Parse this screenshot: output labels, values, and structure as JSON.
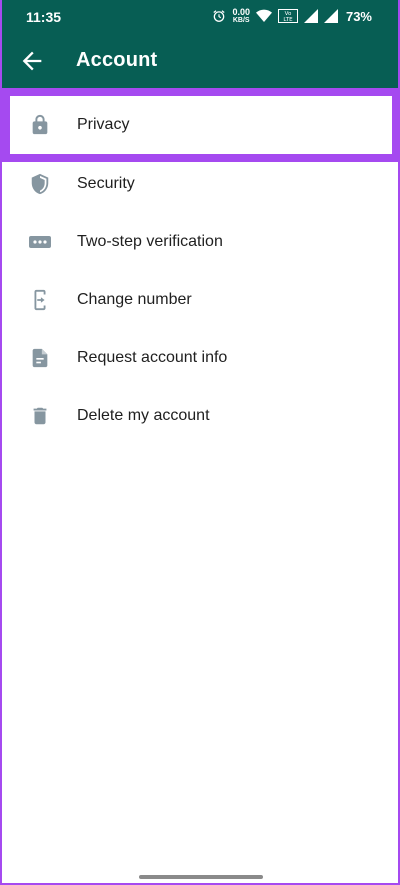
{
  "status_bar": {
    "time": "11:35",
    "net_speed_value": "0.00",
    "net_speed_unit": "KB/S",
    "battery": "73%",
    "icons": [
      "alarm-icon",
      "wifi-icon",
      "volte-icon",
      "signal-icon",
      "signal-icon"
    ]
  },
  "app_bar": {
    "title": "Account",
    "back_icon": "arrow-left-icon"
  },
  "menu": {
    "items": [
      {
        "label": "Privacy",
        "icon": "lock-icon"
      },
      {
        "label": "Security",
        "icon": "shield-icon"
      },
      {
        "label": "Two-step verification",
        "icon": "dots-icon"
      },
      {
        "label": "Change number",
        "icon": "phone-change-icon"
      },
      {
        "label": "Request account info",
        "icon": "document-icon"
      },
      {
        "label": "Delete my account",
        "icon": "trash-icon"
      }
    ]
  },
  "colors": {
    "header": "#075e54",
    "highlight": "#a54af0",
    "icon": "#8696a0"
  }
}
